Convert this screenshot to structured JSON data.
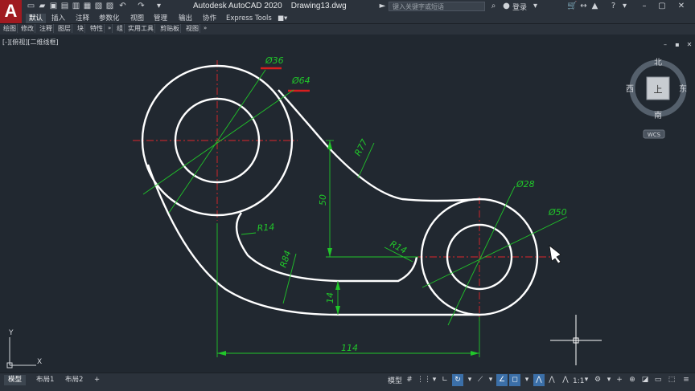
{
  "app": {
    "logo": "A",
    "title": "Autodesk AutoCAD 2020",
    "document": "Drawing13.dwg",
    "search_placeholder": "键入关键字或短语",
    "login": "登录"
  },
  "ribbon_tabs": [
    "默认",
    "插入",
    "注释",
    "参数化",
    "视图",
    "管理",
    "输出",
    "协作",
    "Express Tools"
  ],
  "panel_tabs": [
    "绘图",
    "修改",
    "注释",
    "图层",
    "块",
    "特性",
    "组",
    "实用工具",
    "剪贴板",
    "视图"
  ],
  "viewport_label": "[-][俯视][二维线框]",
  "viewcube": {
    "north": "北",
    "south": "南",
    "east": "东",
    "west": "西",
    "top": "上",
    "wcs": "WCS"
  },
  "ucs": {
    "x": "X",
    "y": "Y"
  },
  "dimensions": {
    "d36": "Ø36",
    "d64": "Ø64",
    "r77": "R77",
    "v50": "50",
    "r14_left": "R14",
    "r14_right": "R14",
    "r84": "R84",
    "v14": "14",
    "d28": "Ø28",
    "d50": "Ø50",
    "h114": "114"
  },
  "layout_tabs": [
    "模型",
    "布局1",
    "布局2"
  ],
  "status": {
    "model": "模型",
    "scale": "1:1"
  },
  "colors": {
    "geometry": "#ffffff",
    "dimension": "#21c62a",
    "centerline": "#e0262b",
    "highlight": "#d81e1e",
    "background": "#212830"
  }
}
